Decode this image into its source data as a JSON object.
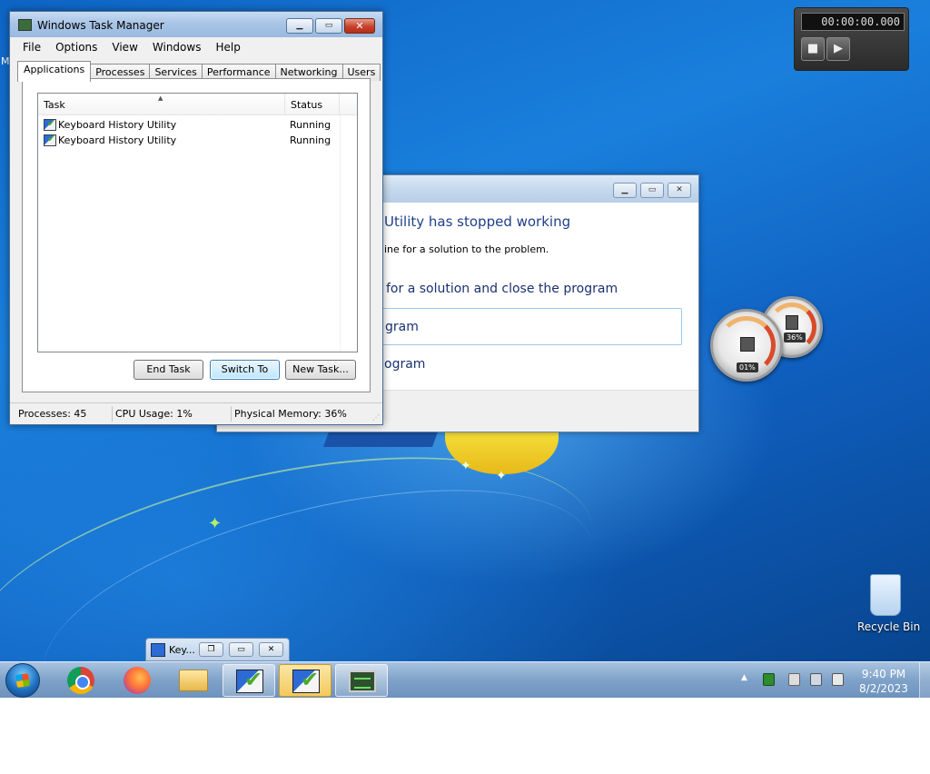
{
  "desktop": {
    "recycle_bin_label": "Recycle Bin",
    "edge_letter": "M"
  },
  "stopwatch": {
    "time": "00:00:00.000"
  },
  "cpu_gadget": {
    "cpu_percent": "01%",
    "memory_percent": "36%"
  },
  "error_dialog": {
    "heading": "Utility has stopped working",
    "subtext": "ine for a solution to the problem.",
    "option_check": "for a solution and close the program",
    "option_close": "gram",
    "option_debug": "ogram"
  },
  "task_manager": {
    "title": "Windows Task Manager",
    "menu": [
      "File",
      "Options",
      "View",
      "Windows",
      "Help"
    ],
    "tabs": [
      "Applications",
      "Processes",
      "Services",
      "Performance",
      "Networking",
      "Users"
    ],
    "active_tab": "Applications",
    "columns": {
      "task": "Task",
      "status": "Status"
    },
    "rows": [
      {
        "task": "Keyboard History Utility",
        "status": "Running"
      },
      {
        "task": "Keyboard History Utility",
        "status": "Running"
      }
    ],
    "buttons": {
      "end_task": "End Task",
      "switch_to": "Switch To",
      "new_task": "New Task..."
    },
    "status": {
      "processes": "Processes: 45",
      "cpu": "CPU Usage: 1%",
      "memory": "Physical Memory: 36%"
    }
  },
  "taskbar_thumb": {
    "label": "Key..."
  },
  "taskbar": {
    "time": "9:40 PM",
    "date": "8/2/2023"
  },
  "colors": {
    "desktop_blue": "#1a7fdc",
    "close_red": "#c6422b",
    "link_blue": "#1e3f8a"
  }
}
